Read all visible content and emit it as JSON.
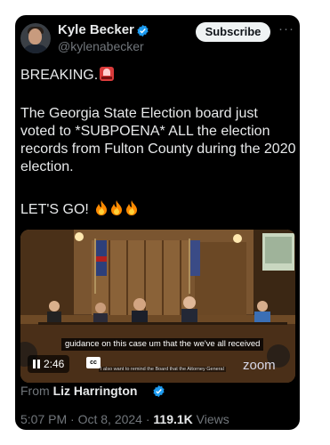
{
  "tweet": {
    "author_name": "Kyle Becker",
    "author_handle": "@kylenabecker",
    "subscribe_label": "Subscribe",
    "more_label": "···",
    "line1": "BREAKING.",
    "body": "The Georgia State Election board just voted to *SUBPOENA* ALL the election records from Fulton County during the 2020 election.",
    "closing": "LET'S GO!",
    "video": {
      "caption": "guidance on this case um that the we've all received",
      "subcaption": "I also want to remind the Board that the Attorney General",
      "time": "2:46",
      "cc_label": "cc",
      "zoom_label": "zoom"
    },
    "from_prefix": "From",
    "from_name": "Liz Harrington",
    "timestamp": "5:07 PM · Oct 8, 2024 · ",
    "views_count": "119.1K",
    "views_label": "Views"
  },
  "colors": {
    "verified": "#1d9bf0",
    "background": "#000000",
    "muted_text": "#71767b"
  }
}
